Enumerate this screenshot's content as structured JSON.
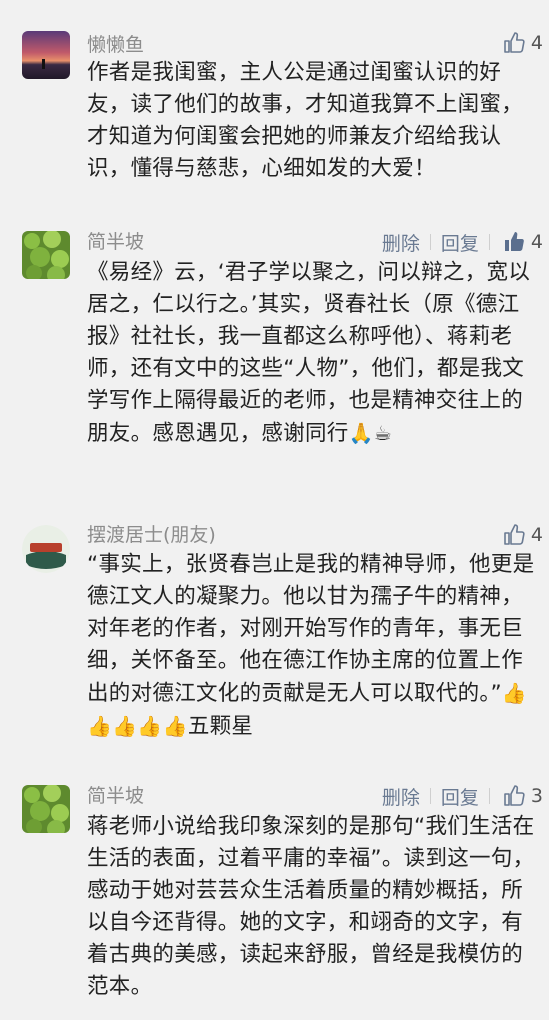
{
  "comments": [
    {
      "name": "懒懒鱼",
      "likes": "4",
      "text": "作者是我闺蜜，主人公是通过闺蜜认识的好友，读了他们的故事，才知道我算不上闺蜜，才知道为何闺蜜会把她的师兼友介绍给我认识，懂得与慈悲，心细如发的大爱！"
    },
    {
      "name": "简半坡",
      "delete_label": "删除",
      "reply_label": "回复",
      "likes": "4",
      "text": "《易经》云，‘君子学以聚之，问以辩之，宽以居之，仁以行之。’其实，贤春社长（原《德江报》社社长，我一直都这么称呼他）、蒋莉老师，还有文中的这些“人物”，他们，都是我文学写作上隔得最近的老师，也是精神交往上的朋友。感恩遇见，感谢同行",
      "emoji": "🙏☕"
    },
    {
      "name": "摆渡居士(朋友)",
      "likes": "4",
      "text": "“事实上，张贤春岂止是我的精神导师，他更是德江文人的凝聚力。他以甘为孺子牛的精神，对年老的作者，对刚开始写作的青年，事无巨细，关怀备至。他在德江作协主席的位置上作出的对德江文化的贡献是无人可以取代的。”",
      "emoji": "👍👍👍👍👍",
      "tail": "五颗星"
    },
    {
      "name": "简半坡",
      "delete_label": "删除",
      "reply_label": "回复",
      "likes": "3",
      "text": "蒋老师小说给我印象深刻的是那句“我们生活在生活的表面，过着平庸的幸福”。读到这一句，感动于她对芸芸众生活着质量的精妙概括，所以自今还背得。她的文字，和翊奇的文字，有着古典的美感，读起来舒服，曾经是我模仿的范本。"
    }
  ],
  "colors": {
    "background": "#f1f1f1",
    "name": "#8c8c8c",
    "action": "#6a7a92"
  },
  "icons": {
    "like": "thumbs-up-outline-icon",
    "liked": "thumbs-up-filled-icon"
  }
}
